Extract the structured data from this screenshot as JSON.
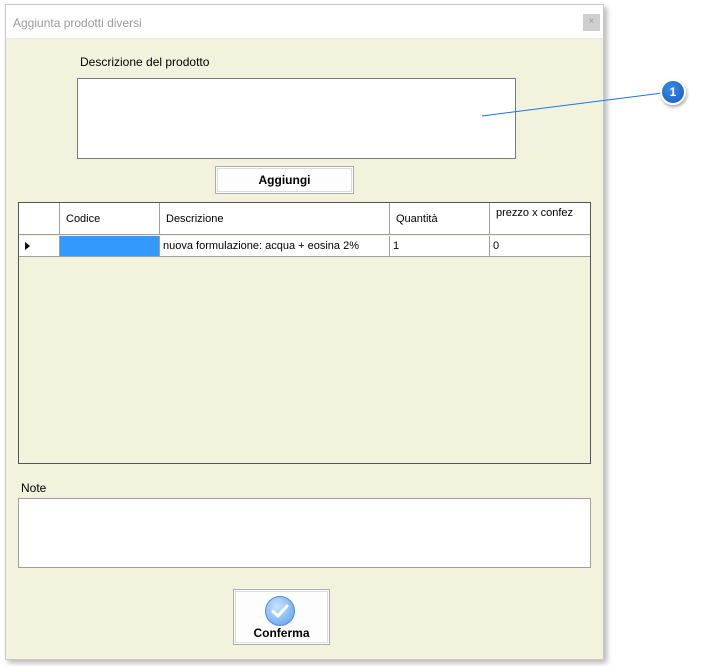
{
  "window": {
    "title": "Aggiunta prodotti diversi",
    "close_glyph": "×"
  },
  "description": {
    "label": "Descrizione del prodotto",
    "value": ""
  },
  "add_button": {
    "label": "Aggiungi"
  },
  "grid": {
    "columns": [
      "",
      "Codice",
      "Descrizione",
      "Quantità",
      "prezzo x confez"
    ],
    "rows": [
      {
        "codice": "",
        "descrizione": "nuova formulazione: acqua + eosina 2%",
        "quantita": "1",
        "prezzo": "0"
      }
    ]
  },
  "note": {
    "label": "Note",
    "value": ""
  },
  "confirm_button": {
    "label": "Conferma",
    "icon": "check-circle-icon"
  },
  "callout": {
    "number": "1",
    "color": "#1a73e8"
  }
}
